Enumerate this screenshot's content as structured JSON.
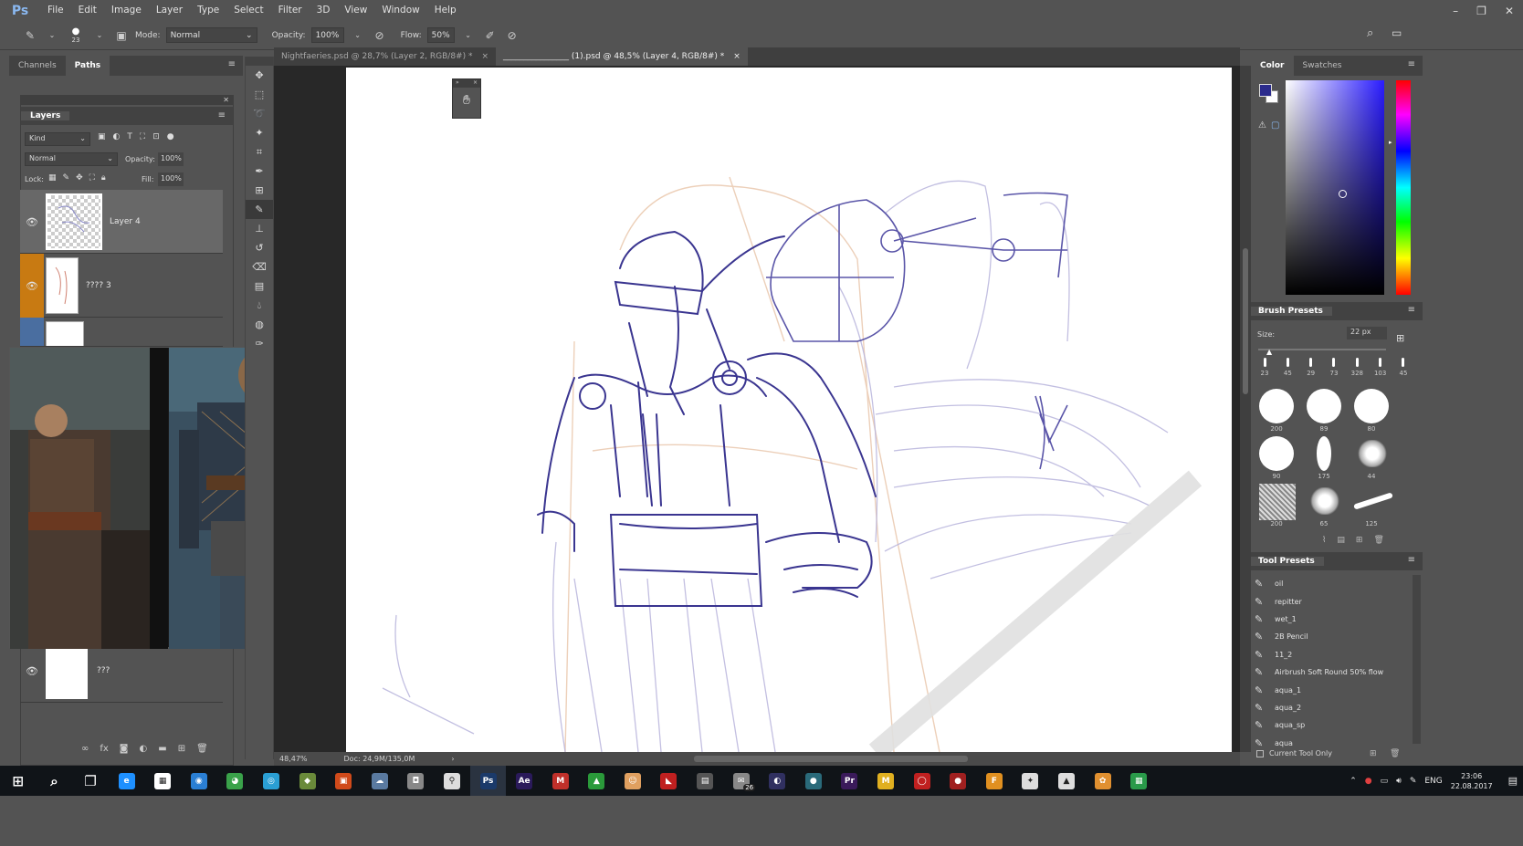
{
  "app": {
    "logo": "Ps"
  },
  "menu": [
    "File",
    "Edit",
    "Image",
    "Layer",
    "Type",
    "Select",
    "Filter",
    "3D",
    "View",
    "Window",
    "Help"
  ],
  "window_controls": [
    "–",
    "❐",
    "✕"
  ],
  "options_bar": {
    "brush_size": "23",
    "mode_label": "Mode:",
    "mode_value": "Normal",
    "opacity_label": "Opacity:",
    "opacity_value": "100%",
    "flow_label": "Flow:",
    "flow_value": "50%"
  },
  "left_panels": {
    "tabs": [
      "Channels",
      "Paths"
    ],
    "active_tab": "Paths",
    "layers_title": "Layers",
    "filter_kind": "Kind",
    "blend_mode": "Normal",
    "opacity_label": "Opacity:",
    "opacity_value": "100%",
    "lock_label": "Lock:",
    "fill_label": "Fill:",
    "fill_value": "100%",
    "layers": [
      {
        "name": "Layer 4",
        "selected": true,
        "color": ""
      },
      {
        "name": "???? 3",
        "selected": false,
        "color": "#c87a12"
      },
      {
        "name": "",
        "selected": false,
        "color": "#4a6ea0"
      },
      {
        "name": "???",
        "selected": false,
        "color": ""
      }
    ]
  },
  "document": {
    "tabs": [
      {
        "title": "Nightfaeries.psd @ 28,7% (Layer 2, RGB/8#) *",
        "active": false
      },
      {
        "title": "________________ (1).psd @ 48,5% (Layer 4, RGB/8#) *",
        "active": true
      }
    ],
    "zoom": "48,47%",
    "doc_info": "Doc: 24,9M/135,0M"
  },
  "color_panel": {
    "tabs": [
      "Color",
      "Swatches"
    ],
    "foreground": "#2b2b8c",
    "background": "#ffffff"
  },
  "brush_presets": {
    "title": "Brush Presets",
    "size_label": "Size:",
    "size_value": "22 px",
    "tip_sizes": [
      "23",
      "45",
      "29",
      "73",
      "328",
      "103",
      "45"
    ],
    "presets": [
      "200",
      "89",
      "80",
      "90",
      "175",
      "44",
      "200",
      "65",
      "125"
    ]
  },
  "tool_presets": {
    "title": "Tool Presets",
    "items": [
      "oil",
      "repitter",
      "wet_1",
      "2B Pencil",
      "11_2",
      "Airbrush Soft Round 50% flow",
      "aqua_1",
      "aqua_2",
      "aqua_sp",
      "aqua"
    ],
    "current_only": "Current Tool Only"
  },
  "taskbar": {
    "language": "ENG",
    "time": "23:06",
    "date": "22.08.2017",
    "mail_badge": "26",
    "apps": [
      {
        "name": "start",
        "color": "#ffffff",
        "label": "⊞"
      },
      {
        "name": "search",
        "color": "#ffffff",
        "label": "⌕"
      },
      {
        "name": "task-view",
        "color": "#ffffff",
        "label": "❐"
      },
      {
        "name": "edge",
        "color": "#1e90ff",
        "label": "e"
      },
      {
        "name": "store",
        "color": "#ffffff",
        "label": "▦"
      },
      {
        "name": "app-blue",
        "color": "#2a7fd4",
        "label": "◉"
      },
      {
        "name": "chrome",
        "color": "#3aa24a",
        "label": "◕"
      },
      {
        "name": "app-cyan",
        "color": "#2a9fd4",
        "label": "◎"
      },
      {
        "name": "app-green",
        "color": "#6a8a3a",
        "label": "◆"
      },
      {
        "name": "app-orange",
        "color": "#d04a1a",
        "label": "▣"
      },
      {
        "name": "app-cloud",
        "color": "#5a7aa0",
        "label": "☁"
      },
      {
        "name": "app-camera",
        "color": "#888888",
        "label": "◘"
      },
      {
        "name": "app-pin",
        "color": "#dddddd",
        "label": "⚲"
      },
      {
        "name": "photoshop",
        "color": "#1b3a6a",
        "label": "Ps"
      },
      {
        "name": "after-effects",
        "color": "#2a1a5a",
        "label": "Ae"
      },
      {
        "name": "app-m",
        "color": "#c0302a",
        "label": "M"
      },
      {
        "name": "app-img",
        "color": "#2a9a3a",
        "label": "▲"
      },
      {
        "name": "app-face",
        "color": "#e0a060",
        "label": "☺"
      },
      {
        "name": "app-red",
        "color": "#c02020",
        "label": "◣"
      },
      {
        "name": "app-film",
        "color": "#555555",
        "label": "▤"
      },
      {
        "name": "mail",
        "color": "#888888",
        "label": "✉"
      },
      {
        "name": "app-circle",
        "color": "#303060",
        "label": "◐"
      },
      {
        "name": "app-teal",
        "color": "#2a6a7a",
        "label": "●"
      },
      {
        "name": "premiere",
        "color": "#3a1a5a",
        "label": "Pr"
      },
      {
        "name": "app-yellow-m",
        "color": "#e0b020",
        "label": "M"
      },
      {
        "name": "app-redcircle",
        "color": "#c02020",
        "label": "◯"
      },
      {
        "name": "app-ball",
        "color": "#a02020",
        "label": "●"
      },
      {
        "name": "app-f",
        "color": "#e09020",
        "label": "F"
      },
      {
        "name": "app-figure",
        "color": "#dddddd",
        "label": "✦"
      },
      {
        "name": "app-landscape",
        "color": "#dddddd",
        "label": "▲"
      },
      {
        "name": "app-orange-flower",
        "color": "#e09030",
        "label": "✿"
      },
      {
        "name": "app-green-doc",
        "color": "#2a9a4a",
        "label": "▦"
      }
    ]
  }
}
